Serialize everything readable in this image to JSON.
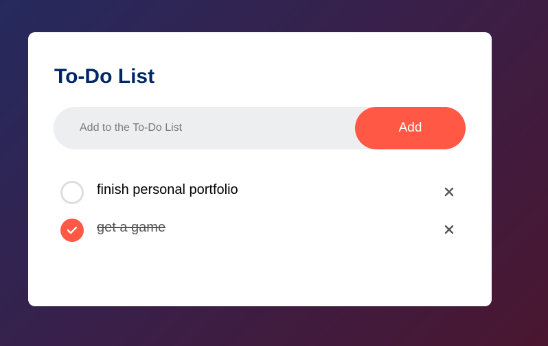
{
  "app": {
    "title": "To-Do List",
    "input": {
      "placeholder": "Add to the To-Do List",
      "value": ""
    },
    "add_label": "Add"
  },
  "todos": [
    {
      "text": "finish personal portfolio",
      "checked": false
    },
    {
      "text": "get a game",
      "checked": true
    }
  ],
  "colors": {
    "accent": "#ff5945",
    "title": "#002765",
    "input_bg": "#edeef0",
    "unchecked_border": "#dddddd"
  },
  "icons": {
    "check": "checkmark-icon",
    "delete": "close-icon"
  }
}
